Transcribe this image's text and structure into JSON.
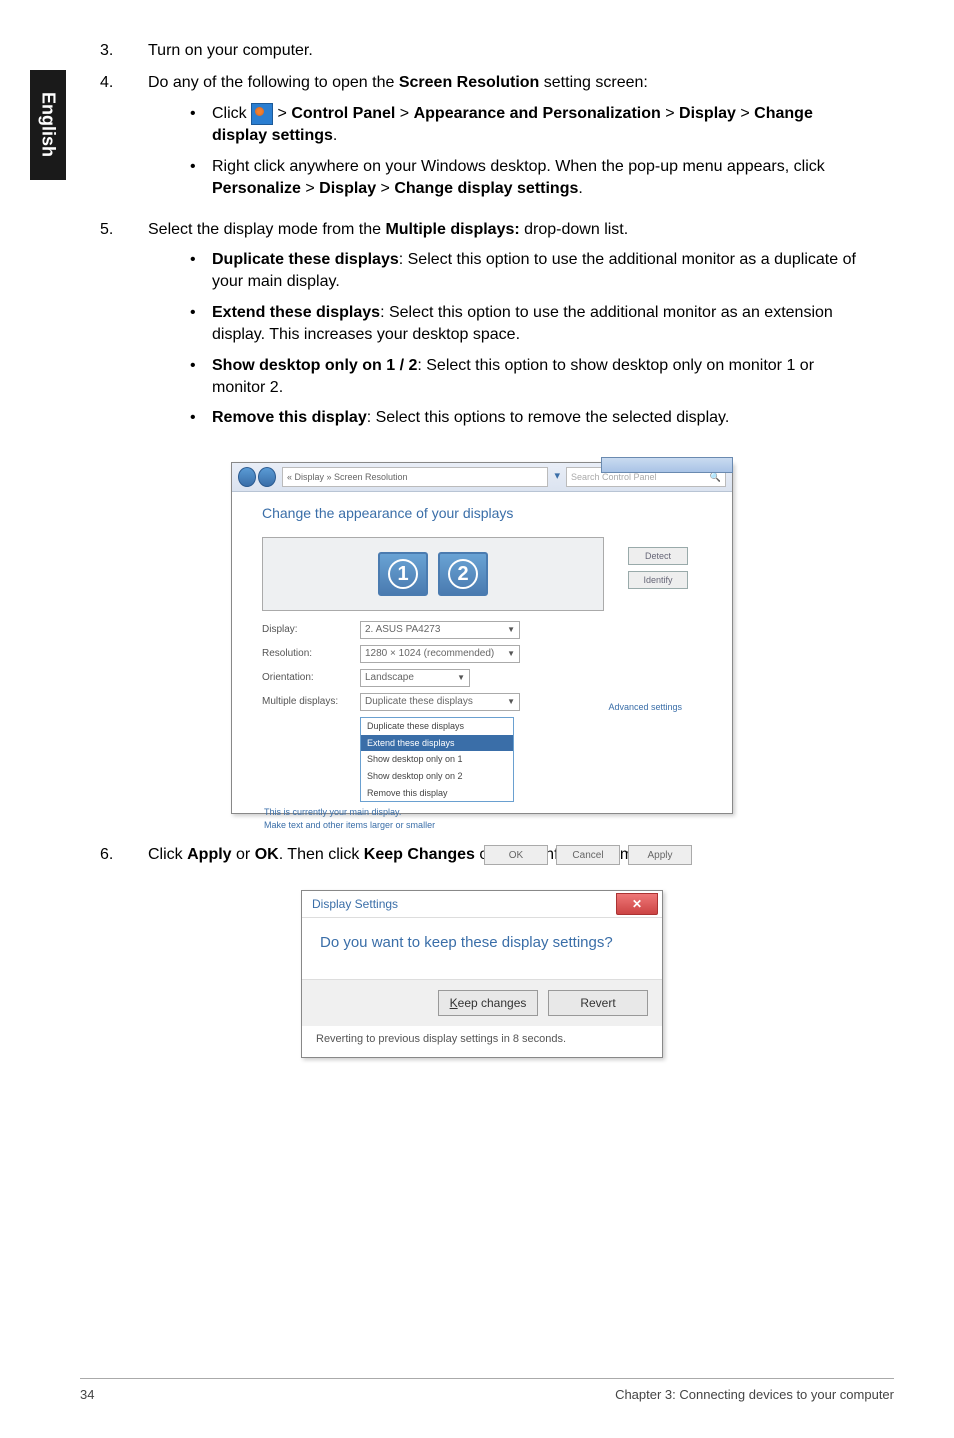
{
  "sidebar": {
    "label": "English"
  },
  "steps": {
    "s3": {
      "num": "3.",
      "text": "Turn on your computer."
    },
    "s4": {
      "num": "4.",
      "intro_pre": "Do any of the following to open the ",
      "intro_bold": "Screen Resolution",
      "intro_post": " setting screen:",
      "b1_pre": "Click ",
      "b1_gt1": " > ",
      "b1_cp": "Control Panel",
      "b1_gt2": " > ",
      "b1_ap": "Appearance and Personalization",
      "b1_gt3": " > ",
      "b1_disp": "Display",
      "b1_gt4": " > ",
      "b1_cds": "Change display settings",
      "b1_dot": ".",
      "b2_pre": "Right click anywhere on your Windows desktop. When the pop-up menu appears, click ",
      "b2_pers": "Personalize",
      "b2_gt1": " > ",
      "b2_disp": "Display",
      "b2_gt2": " > ",
      "b2_cds": "Change display settings",
      "b2_dot": "."
    },
    "s5": {
      "num": "5.",
      "intro_pre": "Select the display mode from the ",
      "intro_bold": "Multiple displays:",
      "intro_post": " drop-down list.",
      "d1_bold": "Duplicate these displays",
      "d1_txt": ": Select this option to use the additional monitor as a duplicate of your main display.",
      "d2_bold": "Extend these displays",
      "d2_txt": ": Select this option to use the additional monitor as an extension display. This increases your desktop space.",
      "d3_bold": "Show desktop only on 1 / 2",
      "d3_txt": ": Select this option to show desktop only on monitor 1 or monitor 2.",
      "d4_bold": "Remove this display",
      "d4_txt": ": Select this options to remove the selected display."
    },
    "s6": {
      "num": "6.",
      "pre": "Click ",
      "apply": "Apply",
      "or": " or ",
      "ok": "OK",
      "mid": ". Then click ",
      "keep": "Keep Changes",
      "post": " on the confirmation message."
    }
  },
  "dlg1": {
    "breadcrumb": "« Display  »  Screen Resolution",
    "search_ph": "Search Control Panel",
    "heading": "Change the appearance of your displays",
    "mon1": "1",
    "mon2": "2",
    "btn_detect": "Detect",
    "btn_identify": "Identify",
    "row_display": "Display:",
    "val_display": "2. ASUS PA4273",
    "row_res": "Resolution:",
    "val_res": "1280 × 1024 (recommended)",
    "row_orient": "Orientation:",
    "val_orient": "Landscape",
    "row_multi": "Multiple displays:",
    "dd_dup": "Duplicate these displays",
    "dd_ext": "Extend these displays",
    "dd_show1": "Show desktop only on 1",
    "dd_show2": "Show desktop only on 2",
    "dd_remove": "Remove this display",
    "note_main": "This is currently your main display.",
    "link_task": "Make text and other items larger or smaller",
    "link_adv": "Advanced settings",
    "btn_ok": "OK",
    "btn_cancel": "Cancel",
    "btn_apply": "Apply",
    "search_icon": "🔍"
  },
  "dlg2": {
    "title": "Display Settings",
    "prompt": "Do you want to keep these display settings?",
    "btn_keep": "Keep changes",
    "btn_revert": "Revert",
    "foot": "Reverting to previous display settings in 8 seconds.",
    "close": "✕"
  },
  "footer": {
    "page": "34",
    "chapter": "Chapter 3: Connecting devices to your computer"
  }
}
